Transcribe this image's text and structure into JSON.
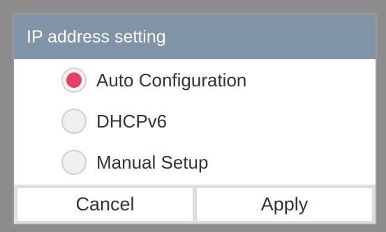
{
  "dialog": {
    "title": "IP address setting",
    "options": [
      {
        "label": "Auto Configuration",
        "selected": true
      },
      {
        "label": "DHCPv6",
        "selected": false
      },
      {
        "label": "Manual Setup",
        "selected": false
      }
    ],
    "buttons": {
      "cancel_label": "Cancel",
      "apply_label": "Apply"
    }
  },
  "colors": {
    "title_bar": "#7f95a7",
    "radio_selected": "#e8406a",
    "background": "#8c8c8c"
  }
}
